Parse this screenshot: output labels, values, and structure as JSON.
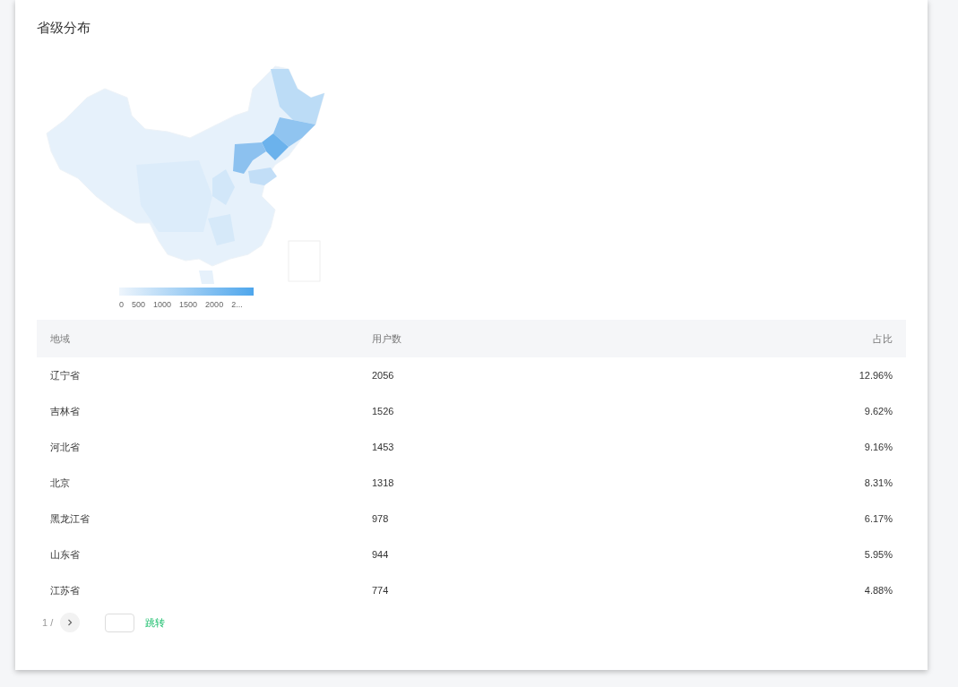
{
  "card": {
    "title": "省级分布"
  },
  "legend": {
    "labels": [
      "0",
      "500",
      "1000",
      "1500",
      "2000",
      "2..."
    ]
  },
  "table": {
    "columns": [
      "地域",
      "用户数",
      "占比"
    ],
    "rows": [
      [
        "辽宁省",
        "2056",
        "12.96%"
      ],
      [
        "吉林省",
        "1526",
        "9.62%"
      ],
      [
        "河北省",
        "1453",
        "9.16%"
      ],
      [
        "北京",
        "1318",
        "8.31%"
      ],
      [
        "黑龙江省",
        "978",
        "6.17%"
      ],
      [
        "山东省",
        "944",
        "5.95%"
      ],
      [
        "江苏省",
        "774",
        "4.88%"
      ]
    ]
  },
  "pagination": {
    "page": "1 /",
    "jump": "跳转"
  }
}
